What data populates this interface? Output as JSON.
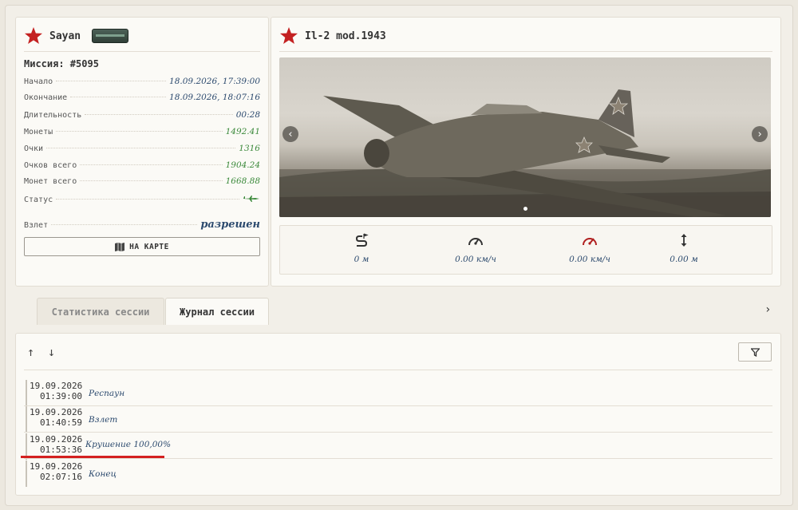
{
  "pilot": {
    "name": "Sayan",
    "mission": "Миссия: #5095",
    "rows": [
      {
        "label": "Начало",
        "value": "18.09.2026, 17:39:00"
      },
      {
        "label": "Окончание",
        "value": "18.09.2026, 18:07:16"
      },
      {
        "label": "Длительность",
        "value": "00:28"
      },
      {
        "label": "Монеты",
        "value": "1492.41"
      },
      {
        "label": "Очки",
        "value": "1316"
      },
      {
        "label": "Очков всего",
        "value": "1904.24"
      },
      {
        "label": "Монет всего",
        "value": "1668.88"
      },
      {
        "label": "Статус",
        "value": ""
      },
      {
        "label": "Взлет",
        "value": "разрешен"
      }
    ],
    "map_button": "НА КАРТЕ"
  },
  "aircraft": {
    "name": "Il-2 mod.1943",
    "stats": [
      {
        "icon": "distance-icon",
        "value": "0 м"
      },
      {
        "icon": "speedometer-icon",
        "value": "0.00 км/ч"
      },
      {
        "icon": "max-speed-icon",
        "value": "0.00 км/ч"
      },
      {
        "icon": "altitude-icon",
        "value": "0.00 м"
      }
    ]
  },
  "tabs": [
    {
      "label": "Статистика сессии",
      "active": false
    },
    {
      "label": "Журнал сессии",
      "active": true
    }
  ],
  "journal": {
    "entries": [
      {
        "date": "19.09.2026",
        "time": "01:39:00",
        "event": "Респаун"
      },
      {
        "date": "19.09.2026",
        "time": "01:40:59",
        "event": "Взлет"
      },
      {
        "date": "19.09.2026",
        "time": "01:53:36",
        "event": "Крушение 100,00%"
      },
      {
        "date": "19.09.2026",
        "time": "02:07:16",
        "event": "Конец"
      }
    ]
  },
  "colors": {
    "star": "#c42121",
    "value_blue": "#2c4a6e",
    "value_green": "#3c8a3c",
    "highlight": "#d42020"
  }
}
